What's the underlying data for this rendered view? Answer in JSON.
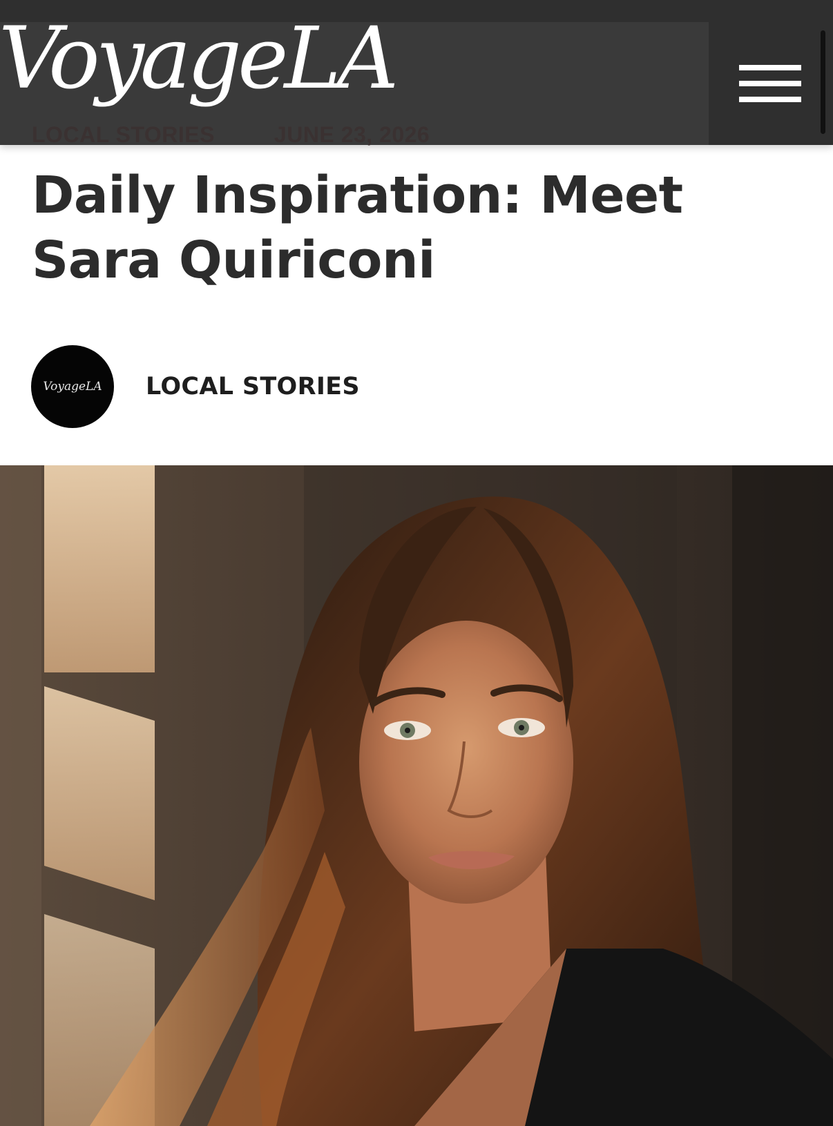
{
  "site": {
    "logo_text": "VoyageLA",
    "menu_icon": "hamburger-menu-icon"
  },
  "header_meta": {
    "category": "LOCAL STORIES",
    "date": "JUNE 23, 2026"
  },
  "article": {
    "title": "Daily Inspiration: Meet Sara Quiriconi",
    "author_avatar_text": "VoyageLA",
    "category_label": "LOCAL STORIES"
  },
  "colors": {
    "header_bg": "#2f2f2f",
    "title_text": "#2c2c2c",
    "avatar_bg": "#050505"
  }
}
